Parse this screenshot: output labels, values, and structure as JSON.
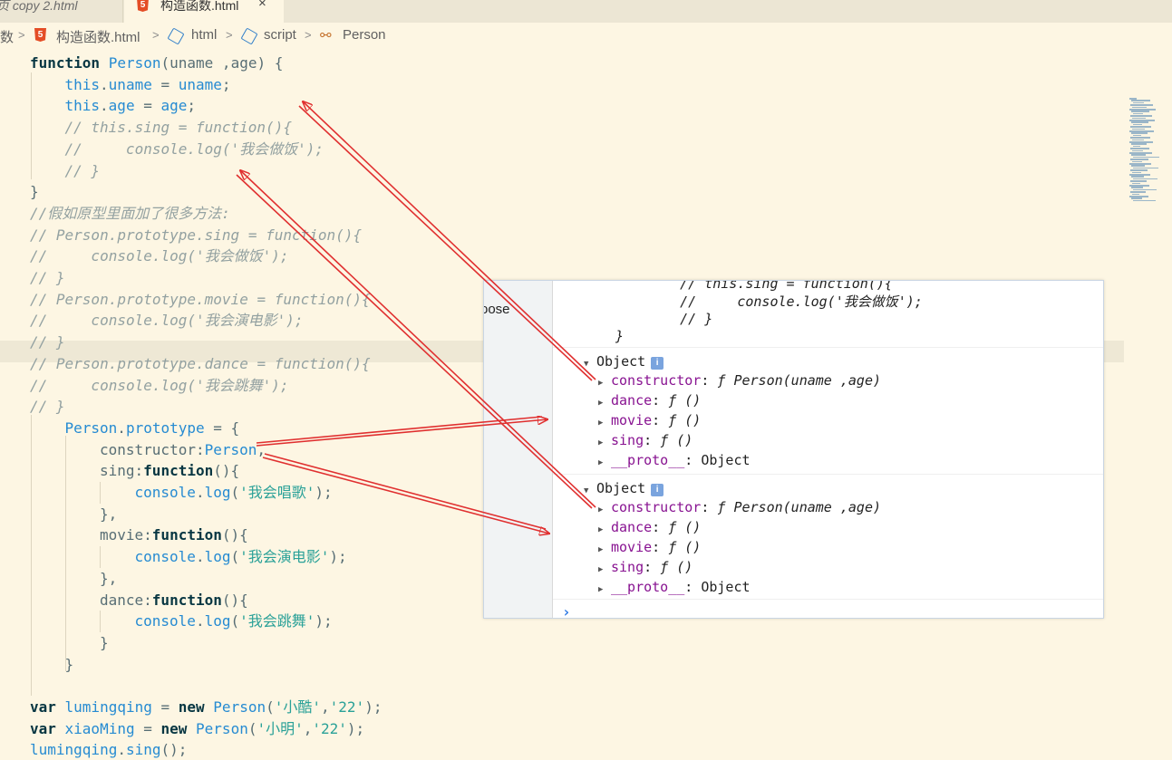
{
  "tabs": {
    "inactive_label": "页 copy 2.html",
    "active_label": "构造函数.html",
    "close_glyph": "×"
  },
  "breadcrumb": {
    "folder": "数",
    "file": "构造函数.html",
    "html": "html",
    "script": "script",
    "symbol": "Person",
    "chevron": ">"
  },
  "code_lines": [
    [
      [
        "kw",
        "function "
      ],
      [
        "fn",
        "Person"
      ],
      [
        "pl",
        "(uname ,age) {"
      ]
    ],
    [
      [
        "var",
        "this"
      ],
      [
        "pl",
        "."
      ],
      [
        "var",
        "uname"
      ],
      [
        "pl",
        " = "
      ],
      [
        "var",
        "uname"
      ],
      [
        "pl",
        ";"
      ]
    ],
    [
      [
        "var",
        "this"
      ],
      [
        "pl",
        "."
      ],
      [
        "var",
        "age"
      ],
      [
        "pl",
        " = "
      ],
      [
        "var",
        "age"
      ],
      [
        "pl",
        ";"
      ]
    ],
    [
      [
        "cm",
        "// this.sing = function(){"
      ]
    ],
    [
      [
        "cm",
        "//     console.log('我会做饭');"
      ]
    ],
    [
      [
        "cm",
        "// }"
      ]
    ],
    [
      [
        "pl",
        "}"
      ]
    ],
    [
      [
        "cm",
        "//假如原型里面加了很多方法:"
      ]
    ],
    [
      [
        "cm",
        "// Person.prototype.sing = function(){"
      ]
    ],
    [
      [
        "cm",
        "//     console.log('我会做饭');"
      ]
    ],
    [
      [
        "cm",
        "// }"
      ]
    ],
    [
      [
        "cm",
        "// Person.prototype.movie = function(){"
      ]
    ],
    [
      [
        "cm",
        "//     console.log('我会演电影');"
      ]
    ],
    [
      [
        "cm",
        "// }"
      ]
    ],
    [
      [
        "cm",
        "// Person.prototype.dance = function(){"
      ]
    ],
    [
      [
        "cm",
        "//     console.log('我会跳舞');"
      ]
    ],
    [
      [
        "cm",
        "// }"
      ]
    ],
    [
      [
        "fn",
        "Person"
      ],
      [
        "pl",
        "."
      ],
      [
        "var",
        "prototype"
      ],
      [
        "pl",
        " = {"
      ]
    ],
    [
      [
        "pl",
        "constructor:"
      ],
      [
        "fn",
        "Person"
      ],
      [
        "pl",
        ","
      ]
    ],
    [
      [
        "pl",
        "sing:"
      ],
      [
        "kw",
        "function"
      ],
      [
        "pl",
        "(){"
      ]
    ],
    [
      [
        "var",
        "console"
      ],
      [
        "pl",
        "."
      ],
      [
        "fn",
        "log"
      ],
      [
        "pl",
        "("
      ],
      [
        "str",
        "'我会唱歌'"
      ],
      [
        "pl",
        ");"
      ]
    ],
    [
      [
        "pl",
        "},"
      ]
    ],
    [
      [
        "pl",
        "movie:"
      ],
      [
        "kw",
        "function"
      ],
      [
        "pl",
        "(){"
      ]
    ],
    [
      [
        "var",
        "console"
      ],
      [
        "pl",
        "."
      ],
      [
        "fn",
        "log"
      ],
      [
        "pl",
        "("
      ],
      [
        "str",
        "'我会演电影'"
      ],
      [
        "pl",
        ");"
      ]
    ],
    [
      [
        "pl",
        "},"
      ]
    ],
    [
      [
        "pl",
        "dance:"
      ],
      [
        "kw",
        "function"
      ],
      [
        "pl",
        "(){"
      ]
    ],
    [
      [
        "var",
        "console"
      ],
      [
        "pl",
        "."
      ],
      [
        "fn",
        "log"
      ],
      [
        "pl",
        "("
      ],
      [
        "str",
        "'我会跳舞'"
      ],
      [
        "pl",
        ");"
      ]
    ],
    [
      [
        "pl",
        "}"
      ]
    ],
    [
      [
        "pl",
        "}"
      ]
    ],
    [],
    [
      [
        "kw",
        "var "
      ],
      [
        "var",
        "lumingqing"
      ],
      [
        "pl",
        " = "
      ],
      [
        "kw",
        "new "
      ],
      [
        "fn",
        "Person"
      ],
      [
        "pl",
        "("
      ],
      [
        "str",
        "'小酷'"
      ],
      [
        "pl",
        ","
      ],
      [
        "str",
        "'22'"
      ],
      [
        "pl",
        ");"
      ]
    ],
    [
      [
        "kw",
        "var "
      ],
      [
        "var",
        "xiaoMing"
      ],
      [
        "pl",
        " = "
      ],
      [
        "kw",
        "new "
      ],
      [
        "fn",
        "Person"
      ],
      [
        "pl",
        "("
      ],
      [
        "str",
        "'小明'"
      ],
      [
        "pl",
        ","
      ],
      [
        "str",
        "'22'"
      ],
      [
        "pl",
        ");"
      ]
    ],
    [
      [
        "var",
        "lumingqing"
      ],
      [
        "pl",
        "."
      ],
      [
        "fn",
        "sing"
      ],
      [
        "pl",
        "();"
      ]
    ]
  ],
  "console": {
    "left_pane_text": "oose",
    "code_lines": [
      "    // this.sing = function(){",
      "    //     console.log('我会做饭');",
      "    // }",
      "}"
    ],
    "objects": [
      {
        "header": "Object",
        "info": "i",
        "props": [
          {
            "key": "constructor",
            "sep": ": ",
            "value": "ƒ Person(uname ,age)"
          },
          {
            "key": "dance",
            "sep": ": ",
            "value": "ƒ ()"
          },
          {
            "key": "movie",
            "sep": ": ",
            "value": "ƒ ()"
          },
          {
            "key": "sing",
            "sep": ": ",
            "value": "ƒ ()"
          },
          {
            "key": "__proto__",
            "sep": ": ",
            "value": "Object"
          }
        ]
      },
      {
        "header": "Object",
        "info": "i",
        "props": [
          {
            "key": "constructor",
            "sep": ": ",
            "value": "ƒ Person(uname ,age)"
          },
          {
            "key": "dance",
            "sep": ": ",
            "value": "ƒ ()"
          },
          {
            "key": "movie",
            "sep": ": ",
            "value": "ƒ ()"
          },
          {
            "key": "sing",
            "sep": ": ",
            "value": "ƒ ()"
          },
          {
            "key": "__proto__",
            "sep": ": ",
            "value": "Object"
          }
        ]
      }
    ],
    "prompt": "›"
  },
  "colors": {
    "editor_bg": "#fdf6e3",
    "annotation_arrow": "#e03030"
  },
  "icons": [
    "html5-file-icon",
    "chevron-right-icon",
    "cube-element-icon",
    "symbol-class-icon",
    "expand-triangle-icon",
    "info-icon",
    "console-prompt-icon"
  ]
}
